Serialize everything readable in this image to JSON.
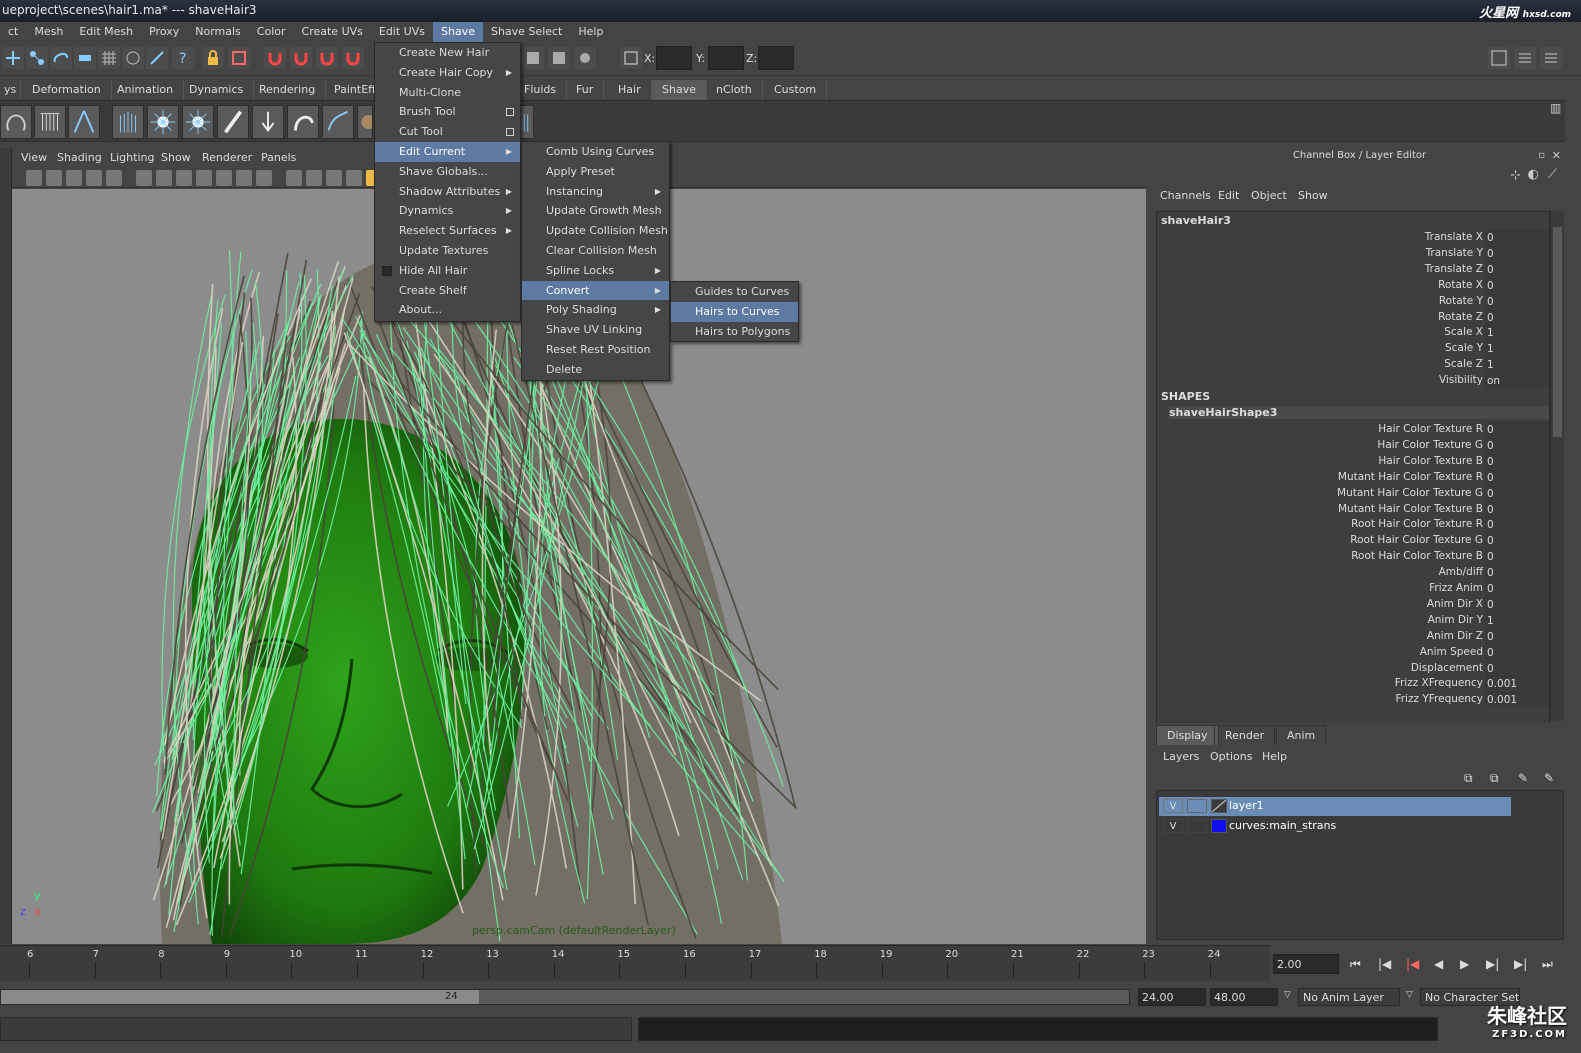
{
  "window": {
    "title": "ueproject\\scenes\\hair1.ma*   ---   shaveHair3",
    "logo": "火星网",
    "logo_sub": "hxsd.com"
  },
  "menubar": [
    "ct",
    "Mesh",
    "Edit Mesh",
    "Proxy",
    "Normals",
    "Color",
    "Create UVs",
    "Edit UVs",
    "Shave",
    "Shave Select",
    "Help"
  ],
  "toolbar": {
    "x_label": "X:",
    "y_label": "Y:",
    "z_label": "Z:",
    "x_value": "",
    "y_value": "",
    "z_value": ""
  },
  "shelf_tabs": [
    "ys",
    "Deformation",
    "Animation",
    "Dynamics",
    "Rendering",
    "PaintEff",
    "Fluids",
    "Fur",
    "Hair",
    "Shave",
    "nCloth",
    "Custom"
  ],
  "shelf_active": "Shave",
  "viewport": {
    "menu": [
      "View",
      "Shading",
      "Lighting",
      "Show",
      "Renderer",
      "Panels"
    ],
    "camera_label": "persp.camCam (defaultRenderLayer)",
    "axis_y": "y",
    "axis_z": "z",
    "axis_x": "x"
  },
  "shave_menu": {
    "items": [
      {
        "label": "Create New Hair"
      },
      {
        "label": "Create Hair Copy",
        "submenu": true
      },
      {
        "label": "Multi-Clone"
      },
      {
        "label": "Brush Tool",
        "option_box": true
      },
      {
        "label": "Cut Tool",
        "option_box": true
      },
      {
        "label": "Edit Current",
        "submenu": true,
        "highlighted": true
      },
      {
        "label": "Shave Globals..."
      },
      {
        "label": "Shadow Attributes",
        "submenu": true
      },
      {
        "label": "Dynamics",
        "submenu": true
      },
      {
        "label": "Reselect Surfaces",
        "submenu": true
      },
      {
        "label": "Update Textures"
      },
      {
        "label": "Hide All Hair",
        "checkbox": true
      },
      {
        "label": "Create Shelf"
      },
      {
        "label": "About..."
      }
    ]
  },
  "edit_current_menu": {
    "items": [
      {
        "label": "Comb Using Curves"
      },
      {
        "label": "Apply Preset"
      },
      {
        "label": "Instancing",
        "submenu": true
      },
      {
        "label": "Update Growth Mesh"
      },
      {
        "label": "Update Collision Mesh"
      },
      {
        "label": "Clear Collision Mesh"
      },
      {
        "label": "Spline Locks",
        "submenu": true
      },
      {
        "label": "Convert",
        "submenu": true,
        "highlighted": true
      },
      {
        "label": "Poly Shading",
        "submenu": true
      },
      {
        "label": "Shave UV Linking"
      },
      {
        "label": "Reset Rest Position"
      },
      {
        "label": "Delete"
      }
    ]
  },
  "convert_menu": {
    "items": [
      {
        "label": "Guides to Curves"
      },
      {
        "label": "Hairs to Curves",
        "highlighted": true
      },
      {
        "label": "Hairs to Polygons"
      }
    ]
  },
  "channel_box": {
    "title": "Channel Box / Layer Editor",
    "menu": [
      "Channels",
      "Edit",
      "Object",
      "Show"
    ],
    "object": "shaveHair3",
    "transform_attrs": [
      {
        "name": "Translate X",
        "value": "0"
      },
      {
        "name": "Translate Y",
        "value": "0"
      },
      {
        "name": "Translate Z",
        "value": "0"
      },
      {
        "name": "Rotate X",
        "value": "0"
      },
      {
        "name": "Rotate Y",
        "value": "0"
      },
      {
        "name": "Rotate Z",
        "value": "0"
      },
      {
        "name": "Scale X",
        "value": "1"
      },
      {
        "name": "Scale Y",
        "value": "1"
      },
      {
        "name": "Scale Z",
        "value": "1"
      },
      {
        "name": "Visibility",
        "value": "on"
      }
    ],
    "shapes_header": "SHAPES",
    "shape_name": "shaveHairShape3",
    "shape_attrs": [
      {
        "name": "Hair Color Texture R",
        "value": "0"
      },
      {
        "name": "Hair Color Texture G",
        "value": "0"
      },
      {
        "name": "Hair Color Texture B",
        "value": "0"
      },
      {
        "name": "Mutant Hair Color Texture R",
        "value": "0"
      },
      {
        "name": "Mutant Hair Color Texture G",
        "value": "0"
      },
      {
        "name": "Mutant Hair Color Texture B",
        "value": "0"
      },
      {
        "name": "Root Hair Color Texture R",
        "value": "0"
      },
      {
        "name": "Root Hair Color Texture G",
        "value": "0"
      },
      {
        "name": "Root Hair Color Texture B",
        "value": "0"
      },
      {
        "name": "Amb/diff",
        "value": "0"
      },
      {
        "name": "Frizz Anim",
        "value": "0"
      },
      {
        "name": "Anim Dir X",
        "value": "0"
      },
      {
        "name": "Anim Dir Y",
        "value": "1"
      },
      {
        "name": "Anim Dir Z",
        "value": "0"
      },
      {
        "name": "Anim Speed",
        "value": "0"
      },
      {
        "name": "Displacement",
        "value": "0"
      },
      {
        "name": "Frizz XFrequency",
        "value": "0.001"
      },
      {
        "name": "Frizz YFrequency",
        "value": "0.001"
      }
    ]
  },
  "layer_editor": {
    "tabs": [
      "Display",
      "Render",
      "Anim"
    ],
    "active_tab": "Display",
    "menu": [
      "Layers",
      "Options",
      "Help"
    ],
    "layers": [
      {
        "visible": "V",
        "name": "layer1",
        "selected": true,
        "color": "#3a3a3a"
      },
      {
        "visible": "V",
        "name": "curves:main_strans",
        "selected": false,
        "color": "#1010ee"
      }
    ]
  },
  "timeline": {
    "ticks": [
      "6",
      "7",
      "8",
      "9",
      "10",
      "11",
      "12",
      "13",
      "14",
      "15",
      "16",
      "17",
      "18",
      "19",
      "20",
      "21",
      "22",
      "23",
      "24"
    ],
    "current_frame": "2.00"
  },
  "range": {
    "slider_label": "24",
    "end": "24.00",
    "anim_end": "48.00",
    "anim_layer": "No Anim Layer",
    "char_set": "No Character Set"
  },
  "watermark": {
    "text": "朱峰社区",
    "sub": "ZF3D.COM"
  },
  "colors": {
    "menu_highlight": "#5c7aa2",
    "head_green": "#2a8a14",
    "hair_guides": "#6ef0a0",
    "viewport_bg": "#8c8c8c"
  }
}
